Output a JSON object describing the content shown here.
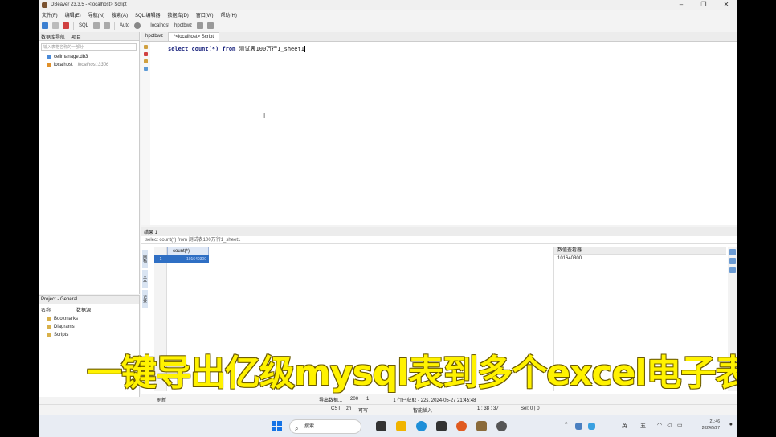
{
  "window": {
    "title": "DBeaver 23.3.5 - <localhost> Script",
    "controls": [
      "–",
      "❐",
      "✕"
    ]
  },
  "menu": [
    "文件(F)",
    "编辑(E)",
    "导航(N)",
    "搜索(A)",
    "SQL 编辑器",
    "数据库(D)",
    "窗口(W)",
    "帮助(H)"
  ],
  "toolbar": {
    "sql_label": "SQL",
    "commit_mode": "Auto",
    "datasource": "localhost",
    "schema": "hpctbwz"
  },
  "navigator": {
    "tab_db": "数据库导航",
    "tab_project": "项目",
    "filter_placeholder": "输入表格名称的一部分",
    "items": [
      {
        "label": "cellmanage.db3",
        "note": ""
      },
      {
        "label": "localhost",
        "note": "localhost:3306"
      }
    ]
  },
  "project": {
    "title": "Project - General",
    "col_name": "名称",
    "col_source": "数据源",
    "items": [
      "Bookmarks",
      "Diagrams",
      "Scripts"
    ]
  },
  "editor": {
    "tabs": [
      "hpctbwz",
      "*<localhost> Script"
    ],
    "code_kw1": "select",
    "code_fn": "count(*)",
    "code_kw2": "from",
    "code_table": "测试表100万行1_sheet1"
  },
  "results": {
    "tab_label": "结果 1",
    "query_echo": "select count(*) from 测试表100万行1_sheet1",
    "side_tabs": [
      "网格",
      "文本",
      "记录"
    ],
    "column_header": "count(*)",
    "row_number": "1",
    "cell_value": "101640300",
    "viewer_title": "数值查看器",
    "viewer_value": "101640300"
  },
  "status": {
    "refresh": "刷新",
    "export": "导出数据...",
    "fetch_size": "200",
    "row_count": "1",
    "fetched": "1 行已获取 - 22s, 2024-05-27 21:45:48",
    "tz": "CST",
    "locale": "zh",
    "writable": "可写",
    "insert_mode": "智能插入",
    "cursor_pos": "1 : 38 : 37",
    "selection": "Sel: 0 | 0"
  },
  "overlay_caption": "一键导出亿级mysql表到多个excel电子表",
  "taskbar": {
    "search_placeholder": "搜索",
    "ime": "英",
    "ime2": "五",
    "time": "21:46",
    "date": "2024/5/27"
  },
  "colors": {
    "accent": "#2f6fc4",
    "caption": "#fff200"
  }
}
